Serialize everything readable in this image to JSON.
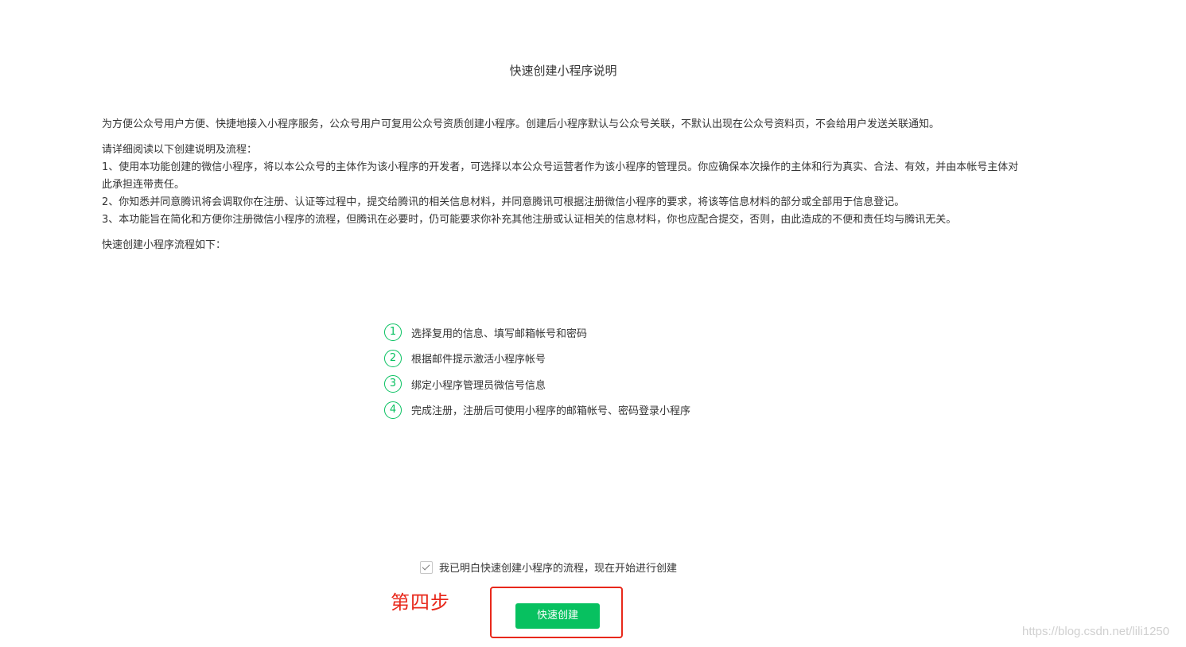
{
  "page_title": "快速创建小程序说明",
  "intro": "为方便公众号用户方便、快捷地接入小程序服务，公众号用户可复用公众号资质创建小程序。创建后小程序默认与公众号关联，不默认出现在公众号资料页，不会给用户发送关联通知。",
  "read_title": "请详细阅读以下创建说明及流程：",
  "rules": [
    "1、使用本功能创建的微信小程序，将以本公众号的主体作为该小程序的开发者，可选择以本公众号运营者作为该小程序的管理员。你应确保本次操作的主体和行为真实、合法、有效，并由本帐号主体对此承担连带责任。",
    "2、你知悉并同意腾讯将会调取你在注册、认证等过程中，提交给腾讯的相关信息材料，并同意腾讯可根据注册微信小程序的要求，将该等信息材料的部分或全部用于信息登记。",
    "3、本功能旨在简化和方便你注册微信小程序的流程，但腾讯在必要时，仍可能要求你补充其他注册或认证相关的信息材料，你也应配合提交，否则，由此造成的不便和责任均与腾讯无关。"
  ],
  "flow_title": "快速创建小程序流程如下：",
  "steps": [
    {
      "num": "1",
      "text": "选择复用的信息、填写邮箱帐号和密码"
    },
    {
      "num": "2",
      "text": "根据邮件提示激活小程序帐号"
    },
    {
      "num": "3",
      "text": "绑定小程序管理员微信号信息"
    },
    {
      "num": "4",
      "text": "完成注册，注册后可使用小程序的邮箱帐号、密码登录小程序"
    }
  ],
  "agree_label": "我已明白快速创建小程序的流程，现在开始进行创建",
  "agree_checked": true,
  "create_button": "快速创建",
  "annotation_label": "第四步",
  "watermark": "https://blog.csdn.net/lili1250",
  "colors": {
    "accent_green": "#07c160",
    "annotation_red": "#e8281b",
    "text": "#353535"
  }
}
